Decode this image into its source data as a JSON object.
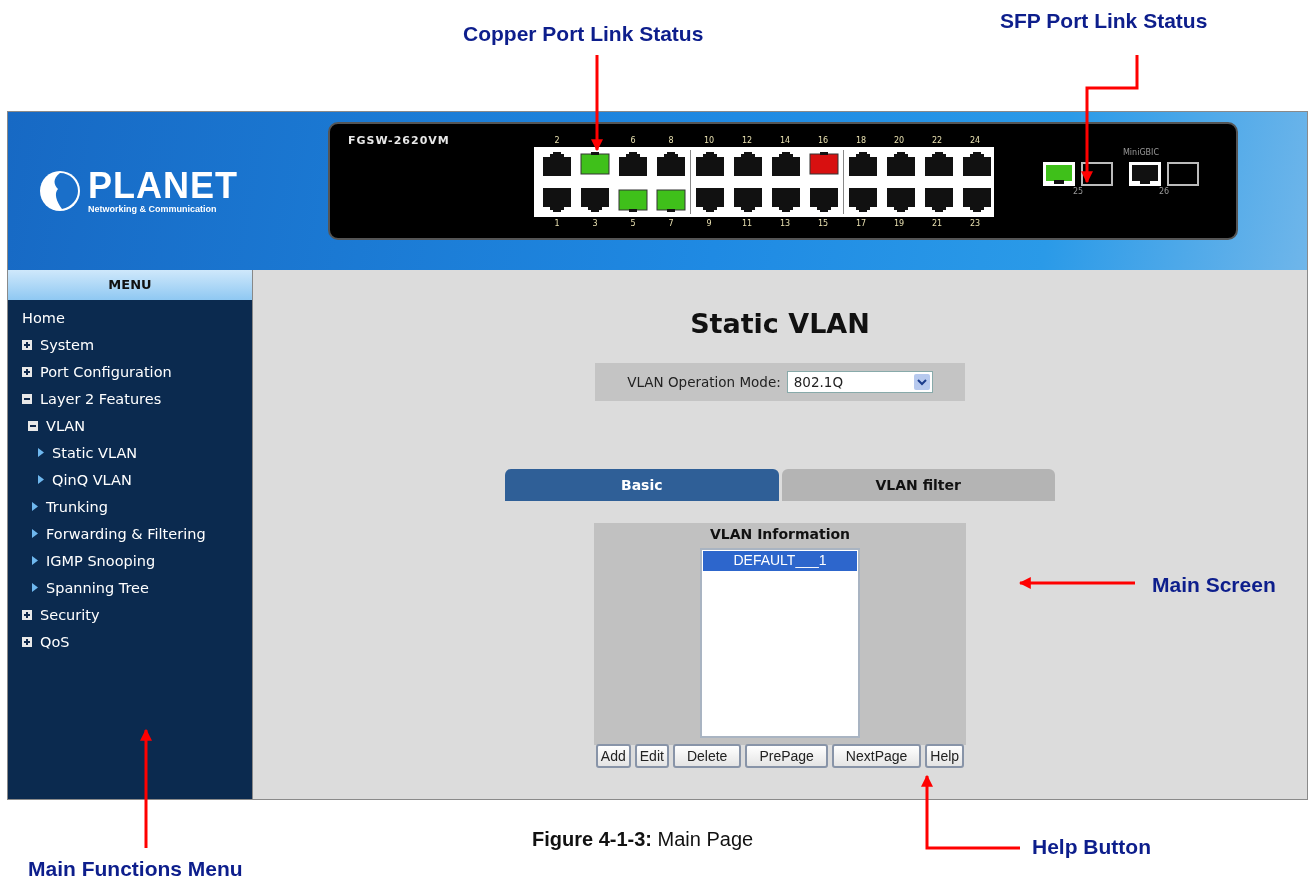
{
  "annotations": [
    {
      "text": "Copper Port Link Status"
    },
    {
      "text": "SFP Port Link Status"
    },
    {
      "text": "Main Screen"
    },
    {
      "text": "Main Functions Menu"
    },
    {
      "text": "Help Button"
    }
  ],
  "logo": {
    "brand": "PLANET",
    "tagline": "Networking & Communication"
  },
  "switch": {
    "model": "FGSW-2620VM",
    "top_row": [
      {
        "label": "2",
        "link_up": false,
        "error": false
      },
      {
        "link_up": true,
        "error": false
      },
      {
        "label": "6",
        "link_up": false,
        "error": false
      },
      {
        "label": "8",
        "link_up": false,
        "error": false
      },
      {
        "label": "10",
        "link_up": false,
        "error": false
      },
      {
        "label": "12",
        "link_up": false,
        "error": false
      },
      {
        "label": "14",
        "link_up": false,
        "error": false
      },
      {
        "label": "16",
        "link_up": false,
        "error": true
      },
      {
        "label": "18",
        "link_up": false,
        "error": false
      },
      {
        "label": "20",
        "link_up": false,
        "error": false
      },
      {
        "label": "22",
        "link_up": false,
        "error": false
      },
      {
        "label": "24",
        "link_up": false,
        "error": false
      }
    ],
    "bottom_row": [
      {
        "label": "1",
        "link_up": false,
        "error": false
      },
      {
        "label": "3",
        "link_up": false,
        "error": false
      },
      {
        "label": "5",
        "link_up": true,
        "error": false
      },
      {
        "label": "7",
        "link_up": true,
        "error": false
      },
      {
        "label": "9",
        "link_up": false,
        "error": false
      },
      {
        "label": "11",
        "link_up": false,
        "error": false
      },
      {
        "label": "13",
        "link_up": false,
        "error": false
      },
      {
        "label": "15",
        "link_up": false,
        "error": false
      },
      {
        "label": "17",
        "link_up": false,
        "error": false
      },
      {
        "label": "19",
        "link_up": false,
        "error": false
      },
      {
        "label": "21",
        "link_up": false,
        "error": false
      },
      {
        "label": "23",
        "link_up": false,
        "error": false
      }
    ],
    "sfp_title": "MiniGBIC",
    "sfp_ports": [
      {
        "label": "25",
        "copper_link_up": true,
        "fiber_link_up": false
      },
      {
        "label": "26",
        "copper_link_up": false,
        "fiber_link_up": false
      }
    ]
  },
  "menu": {
    "title": "MENU",
    "items": [
      {
        "label": "Home",
        "kind": "link"
      },
      {
        "label": "System",
        "kind": "folder",
        "expanded": false
      },
      {
        "label": "Port Configuration",
        "kind": "folder",
        "expanded": false
      },
      {
        "label": "Layer 2 Features",
        "kind": "folder",
        "expanded": true,
        "children": [
          {
            "label": "VLAN",
            "kind": "folder",
            "expanded": true,
            "children": [
              {
                "label": "Static VLAN",
                "kind": "page"
              },
              {
                "label": "QinQ VLAN",
                "kind": "page"
              }
            ]
          },
          {
            "label": "Trunking",
            "kind": "page"
          },
          {
            "label": "Forwarding & Filtering",
            "kind": "page"
          },
          {
            "label": "IGMP Snooping",
            "kind": "page"
          },
          {
            "label": "Spanning Tree",
            "kind": "page"
          }
        ]
      },
      {
        "label": "Security",
        "kind": "folder",
        "expanded": false
      },
      {
        "label": "QoS",
        "kind": "folder",
        "expanded": false
      }
    ]
  },
  "main": {
    "title": "Static VLAN",
    "mode_label": "VLAN Operation Mode:",
    "mode_value": "802.1Q",
    "tabs": [
      {
        "label": "Basic",
        "selected": true
      },
      {
        "label": "VLAN filter",
        "selected": false
      }
    ],
    "info_title": "VLAN Information",
    "vlans": [
      {
        "label": "DEFAULT___1",
        "selected": true
      }
    ],
    "buttons": [
      "Add",
      "Edit",
      "Delete",
      "PrePage",
      "NextPage",
      "Help"
    ]
  },
  "caption": "**Figure 4-1-3:** Main Page"
}
